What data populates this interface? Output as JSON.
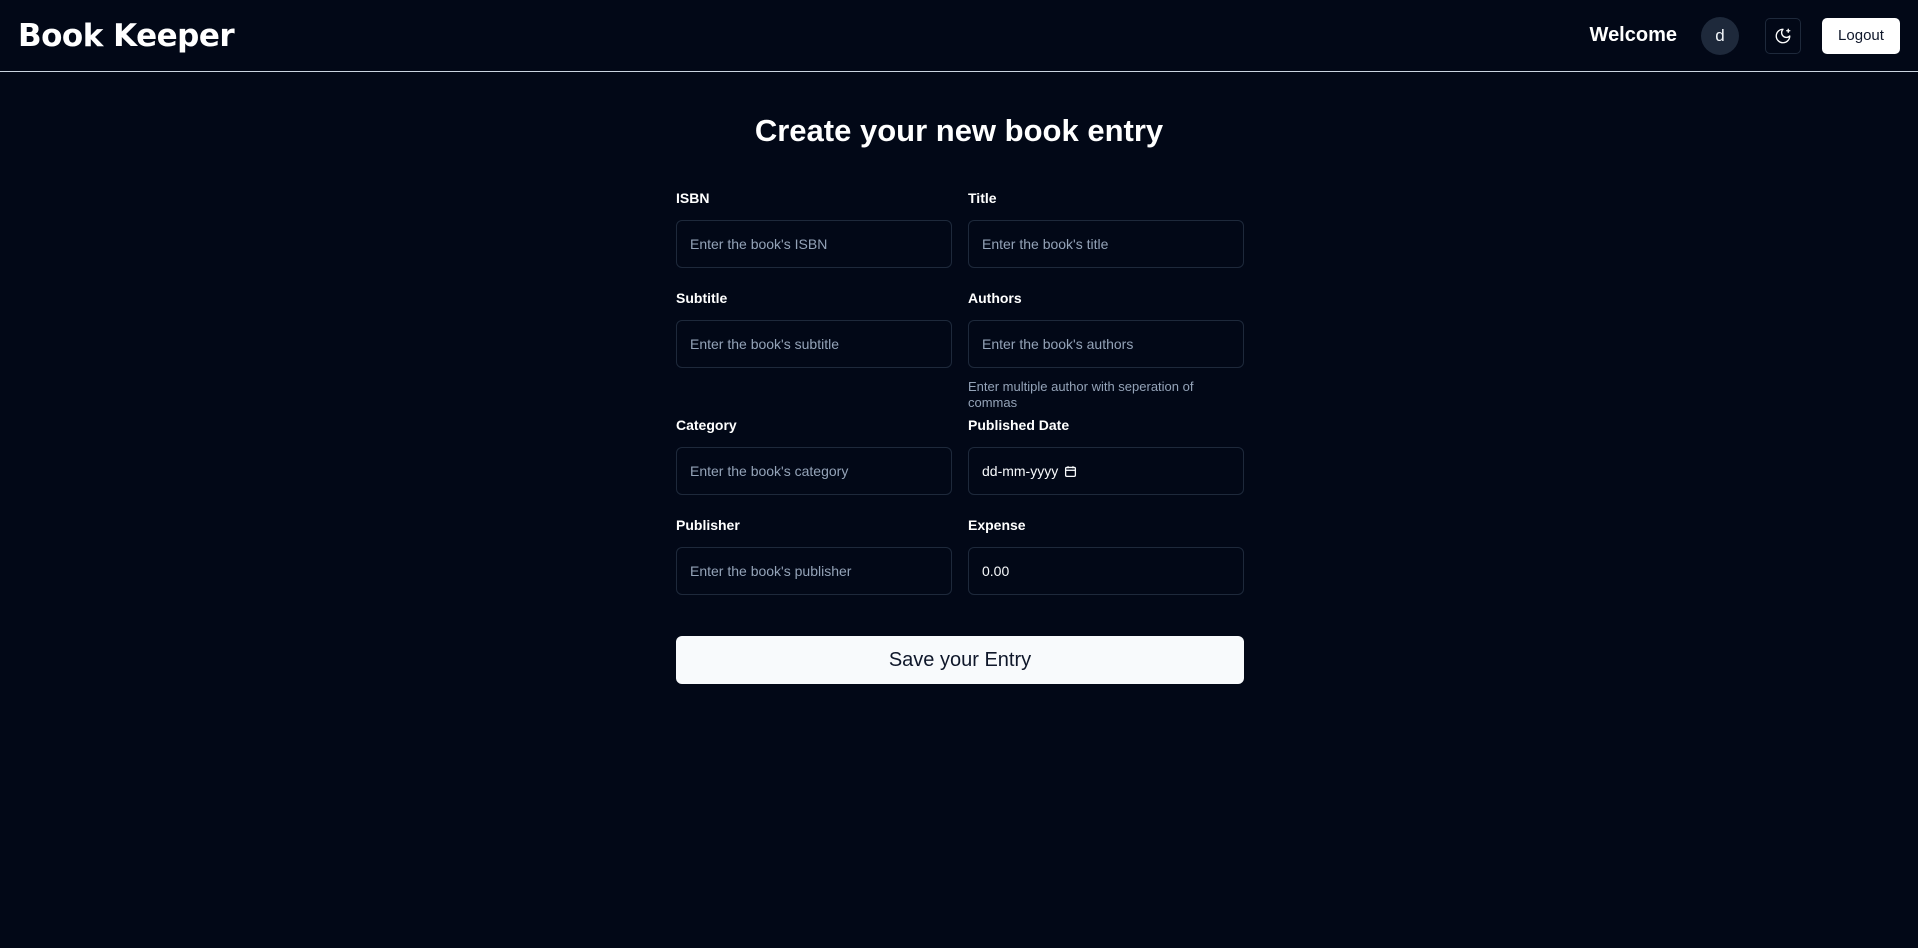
{
  "app": {
    "brand": "Book Keeper"
  },
  "header": {
    "welcome": "Welcome",
    "avatar_initial": "d",
    "theme_toggle_icon": "moon-stars-icon",
    "logout_label": "Logout"
  },
  "page": {
    "title": "Create your new book entry"
  },
  "form": {
    "isbn": {
      "label": "ISBN",
      "placeholder": "Enter the book's ISBN",
      "value": ""
    },
    "title": {
      "label": "Title",
      "placeholder": "Enter the book's title",
      "value": ""
    },
    "subtitle": {
      "label": "Subtitle",
      "placeholder": "Enter the book's subtitle",
      "value": ""
    },
    "authors": {
      "label": "Authors",
      "placeholder": "Enter the book's authors",
      "value": "",
      "hint": "Enter multiple author with seperation of commas"
    },
    "category": {
      "label": "Category",
      "placeholder": "Enter the book's category",
      "value": ""
    },
    "published_date": {
      "label": "Published Date",
      "display": "dd-mm-yyyy",
      "icon": "calendar-icon"
    },
    "publisher": {
      "label": "Publisher",
      "placeholder": "Enter the book's publisher",
      "value": ""
    },
    "expense": {
      "label": "Expense",
      "value": "0.00"
    },
    "submit_label": "Save your Entry"
  },
  "colors": {
    "background": "#020817",
    "border": "#1e293b",
    "muted_text": "#94a3b8",
    "button_bg": "#f8fafc"
  }
}
